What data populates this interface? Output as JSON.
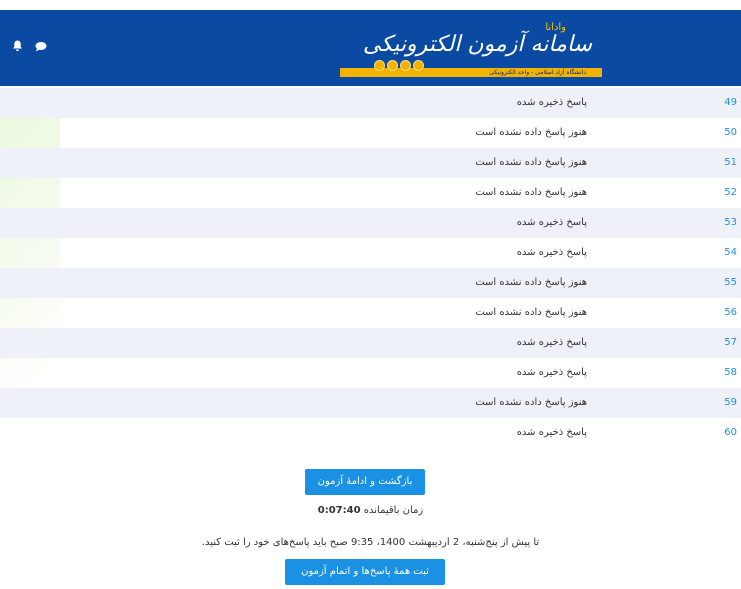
{
  "header": {
    "bell_icon": "bell-icon",
    "chat_icon": "chat-bubble-icon",
    "logo_title": "سامانه آزمون الکترونیکی",
    "logo_top": "وادانا",
    "logo_university": "دانشگاه آزاد اسلامی - واحد الکترونیکی"
  },
  "answers": [
    {
      "number": "49",
      "status": "پاسخ ذخیره شده"
    },
    {
      "number": "50",
      "status": "هنوز پاسخ داده نشده است"
    },
    {
      "number": "51",
      "status": "هنوز پاسخ داده نشده است"
    },
    {
      "number": "52",
      "status": "هنوز پاسخ داده نشده است"
    },
    {
      "number": "53",
      "status": "پاسخ ذخیره شده"
    },
    {
      "number": "54",
      "status": "پاسخ ذخیره شده"
    },
    {
      "number": "55",
      "status": "هنوز پاسخ داده نشده است"
    },
    {
      "number": "56",
      "status": "هنوز پاسخ داده نشده است"
    },
    {
      "number": "57",
      "status": "پاسخ ذخیره شده"
    },
    {
      "number": "58",
      "status": "پاسخ ذخیره شده"
    },
    {
      "number": "59",
      "status": "هنوز پاسخ داده نشده است"
    },
    {
      "number": "60",
      "status": "پاسخ ذخیره شده"
    }
  ],
  "actions": {
    "return_label": "بازگشت و ادامهٔ آزمون",
    "remaining_label": "زمان باقیمانده",
    "remaining_time": "0:07:40",
    "deadline_text": "تا پیش از پنج‌شنبه، 2 اردیبهشت 1400، 9:35 صبح باید پاسخ‌های خود را ثبت کنید.",
    "submit_label": "ثبت همهٔ پاسخ‌ها و اتمام آزمون"
  },
  "colors": {
    "header_bg": "#0b4aa2",
    "button_bg": "#1a91e3",
    "number_link": "#1f8fe0",
    "row_stripe": "#eef2f8"
  }
}
